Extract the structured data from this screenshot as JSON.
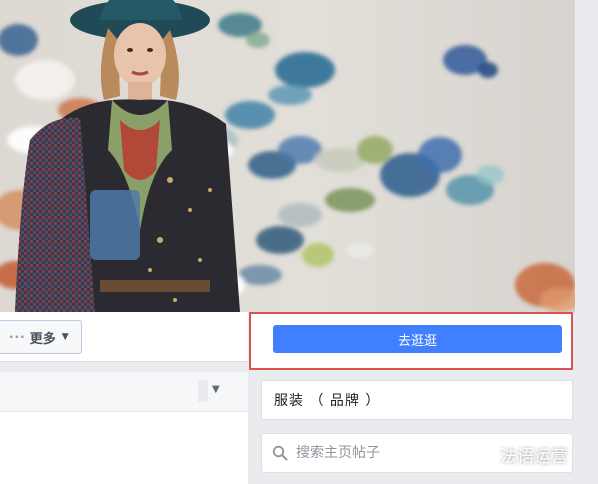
{
  "nav": {
    "more_label": "更多",
    "more_dots": "···"
  },
  "cta": {
    "label": "去逛逛"
  },
  "category": {
    "label": "服装 （ 品牌 ）"
  },
  "search": {
    "placeholder": "搜索主页帖子",
    "value": ""
  },
  "watermark": {
    "text": "法语运营"
  },
  "colors": {
    "cta_blue": "#4080ff",
    "highlight_red": "#d9534f",
    "page_bg": "#e9ebee"
  },
  "icons": [
    "search-icon",
    "chevron-down-icon",
    "wechat-logo-icon"
  ]
}
